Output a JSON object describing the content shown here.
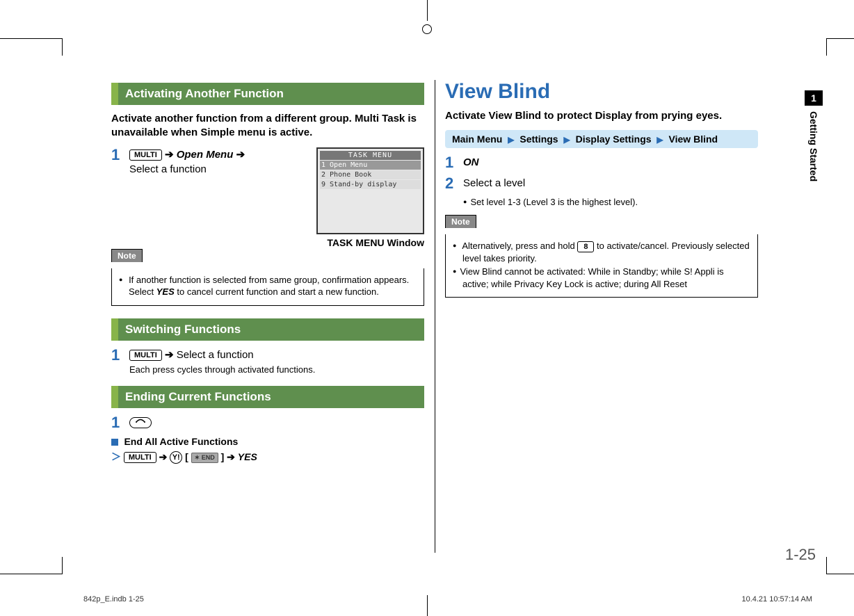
{
  "side_tab": {
    "number": "1",
    "label": "Getting Started"
  },
  "page_number": "1-25",
  "footer": {
    "left": "842p_E.indb   1-25",
    "right": "10.4.21   10:57:14 AM"
  },
  "left": {
    "h1": "Activating Another Function",
    "lead": "Activate another function from a different group. Multi Task is unavailable when Simple menu is active.",
    "step1": {
      "key": "MULTI",
      "open_menu": "Open Menu",
      "select": "Select a function"
    },
    "screenshot": {
      "title": "TASK MENU",
      "rows": [
        "1  Open Menu",
        "2  Phone Book",
        "9  Stand-by display"
      ],
      "caption": "TASK MENU Window"
    },
    "note1_label": "Note",
    "note1_text_a": "If another function is selected from same group, confirmation appears. Select ",
    "note1_yes": "YES",
    "note1_text_b": " to cancel current function and start a new function.",
    "h2": "Switching Functions",
    "switch_step": {
      "key": "MULTI",
      "text": "Select a function",
      "sub": "Each press cycles through activated functions."
    },
    "h3": "Ending Current Functions",
    "end_key_glyph": "⌐",
    "end_all_label": "End All Active Functions",
    "end_seq": {
      "key1": "MULTI",
      "key2": "Y!",
      "badge": "END",
      "yes": "YES"
    }
  },
  "right": {
    "title": "View Blind",
    "lead": "Activate View Blind to protect Display from prying eyes.",
    "nav": {
      "a": "Main Menu",
      "b": "Settings",
      "c": "Display Settings",
      "d": "View Blind"
    },
    "step1_on": "ON",
    "step2_text": "Select a level",
    "step2_sub": "Set level 1-3 (Level 3 is the highest level).",
    "note_label": "Note",
    "note_items": {
      "a1": "Alternatively, press and hold ",
      "a_key": "8",
      "a2": " to activate/cancel. Previously selected level takes priority.",
      "b": "View Blind cannot be activated: While in Standby; while S! Appli is active; while Privacy Key Lock is active; during All Reset"
    }
  }
}
